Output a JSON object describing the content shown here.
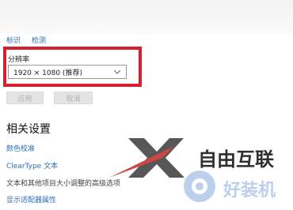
{
  "top_links": [
    "标识",
    "检测"
  ],
  "resolution": {
    "label": "分辨率",
    "selected": "1920 × 1080 (推荐)"
  },
  "buttons": {
    "apply": "应用",
    "cancel": "取消"
  },
  "related": {
    "title": "相关设置",
    "links": [
      "颜色校准",
      "ClearType 文本",
      "文本和其他项目大小调整的高级选项",
      "显示适配器属性"
    ]
  },
  "watermark": {
    "text1": "自由互联",
    "text2": "好装机"
  },
  "colors": {
    "highlight": "#d81f2a",
    "link": "#2b6fb6"
  }
}
